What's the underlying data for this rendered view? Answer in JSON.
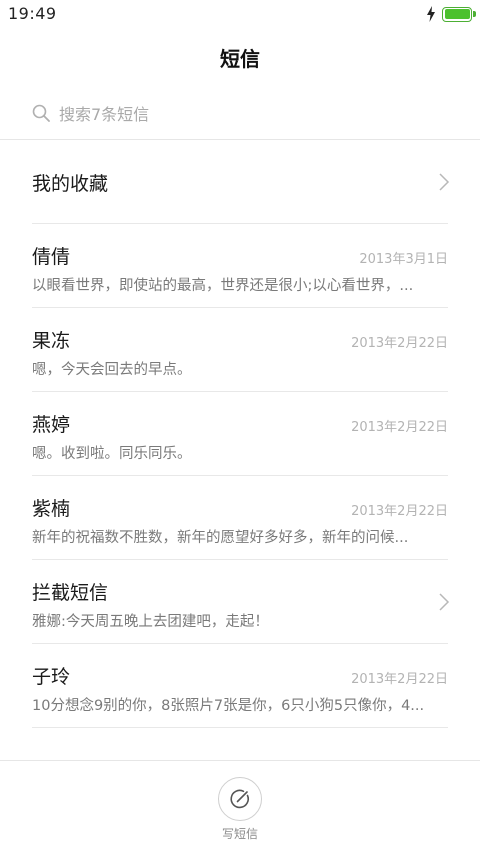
{
  "status_bar": {
    "time": "19:49",
    "icons": [
      "charging-bolt-icon",
      "battery-full-icon"
    ],
    "battery_color": "#4cc12e",
    "battery_level": 1.0
  },
  "header": {
    "title": "短信"
  },
  "search": {
    "placeholder": "搜索7条短信",
    "icon": "search-icon"
  },
  "conversations": [
    {
      "title": "我的收藏",
      "kind": "folder",
      "icon": "chevron-right-icon"
    },
    {
      "title": "倩倩",
      "date": "2013年3月1日",
      "preview": "以眼看世界，即使站的最高，世界还是很小;以心看世界，..."
    },
    {
      "title": "果冻",
      "date": "2013年2月22日",
      "preview": "嗯，今天会回去的早点。"
    },
    {
      "title": "燕婷",
      "date": "2013年2月22日",
      "preview": "嗯。收到啦。同乐同乐。"
    },
    {
      "title": "紫楠",
      "date": "2013年2月22日",
      "preview": "新年的祝福数不胜数，新年的愿望好多好多，新年的问候..."
    },
    {
      "title": "拦截短信",
      "kind": "folder",
      "icon": "chevron-right-icon",
      "preview": "雅娜:今天周五晚上去团建吧，走起！"
    },
    {
      "title": "子玲",
      "date": "2013年2月22日",
      "preview": "10分想念9别的你，8张照片7张是你，6只小狗5只像你，4..."
    }
  ],
  "bottom_bar": {
    "compose_label": "写短信",
    "compose_icon": "compose-icon"
  }
}
